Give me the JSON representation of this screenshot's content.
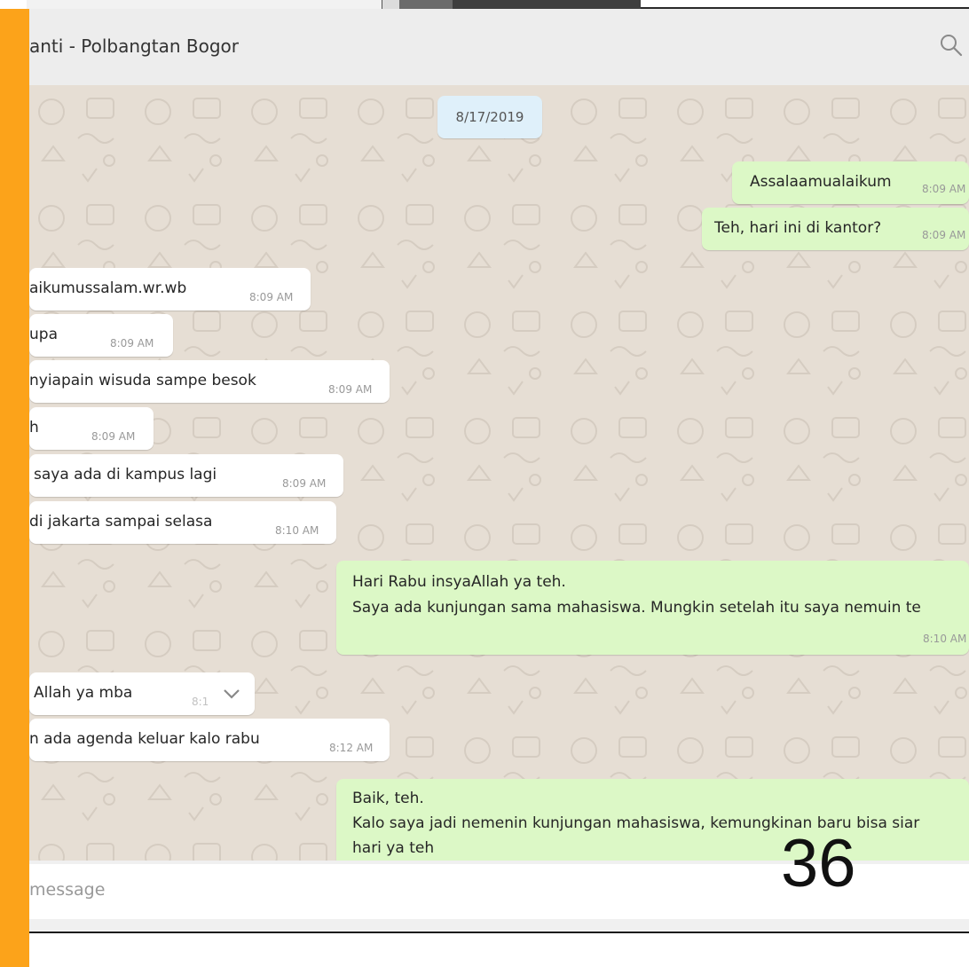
{
  "header": {
    "title": "anti - Polbangtan Bogor"
  },
  "date_chip": "8/17/2019",
  "messages": [
    {
      "dir": "out",
      "text": "Assalaamualaikum",
      "time": "8:09 AM"
    },
    {
      "dir": "out",
      "text": "Teh, hari ini di kantor?",
      "time": "8:09 AM"
    },
    {
      "dir": "in",
      "text": "aikumussalam.wr.wb",
      "time": "8:09 AM"
    },
    {
      "dir": "in",
      "text": "upa",
      "time": "8:09 AM"
    },
    {
      "dir": "in",
      "text": "nyiapain wisuda sampe besok",
      "time": "8:09 AM"
    },
    {
      "dir": "in",
      "text": "h",
      "time": "8:09 AM"
    },
    {
      "dir": "in",
      "text": "saya ada di kampus lagi",
      "time": "8:09 AM"
    },
    {
      "dir": "in",
      "text": "di jakarta sampai selasa",
      "time": "8:10 AM"
    },
    {
      "dir": "out",
      "line1": "Hari Rabu insyaAllah ya teh.",
      "line2": "Saya ada kunjungan sama mahasiswa. Mungkin setelah itu saya nemuin te",
      "time": "8:10 AM"
    },
    {
      "dir": "in",
      "text": "Allah ya mba",
      "time": "8:1"
    },
    {
      "dir": "in",
      "text": "n ada agenda keluar kalo rabu",
      "time": "8:12 AM"
    },
    {
      "dir": "out",
      "line1": "Baik, teh.",
      "line2": "Kalo saya jadi nemenin kunjungan mahasiswa, kemungkinan baru bisa siar",
      "line3": "hari ya teh"
    }
  ],
  "compose": {
    "placeholder": "message"
  },
  "page_number": "36",
  "colors": {
    "accent_bar": "#fca31a",
    "outgoing": "#dcf8c6",
    "incoming": "#ffffff",
    "chat_bg": "#e6ded4"
  },
  "icons": {
    "search": "search-icon",
    "chevron": "chevron-down-icon"
  }
}
